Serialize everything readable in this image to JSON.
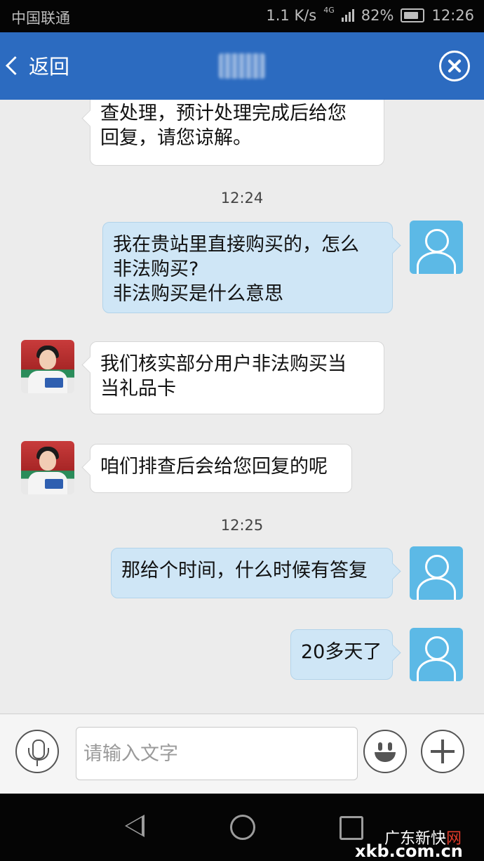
{
  "status_bar": {
    "carrier": "中国联通",
    "network_speed": "1.1 K/s",
    "network_type": "4G",
    "battery_percent": "82%",
    "time": "12:26"
  },
  "nav_bar": {
    "back_label": "返回",
    "color": "#2c6bc0"
  },
  "messages": [
    {
      "sender": "agent",
      "lines": [
        "查处理，预计处理完成后给您",
        "回复，请您谅解。"
      ]
    },
    {
      "timestamp": "12:24"
    },
    {
      "sender": "user",
      "lines": [
        "我在贵站里直接购买的，怎么",
        "非法购买?",
        "非法购买是什么意思"
      ]
    },
    {
      "sender": "agent",
      "lines": [
        "我们核实部分用户非法购买当",
        "当礼品卡"
      ]
    },
    {
      "sender": "agent",
      "lines": [
        "咱们排查后会给您回复的呢"
      ]
    },
    {
      "timestamp": "12:25"
    },
    {
      "sender": "user",
      "lines": [
        "那给个时间，什么时候有答复"
      ]
    },
    {
      "sender": "user",
      "lines": [
        "20多天了"
      ]
    }
  ],
  "input_bar": {
    "placeholder": "请输入文字"
  },
  "watermark": {
    "name_prefix": "广东新快",
    "name_accent": "网",
    "url": "xkb.com.cn"
  },
  "colors": {
    "user_bubble": "#cfe6f6",
    "agent_bubble": "#ffffff",
    "user_avatar": "#5cb9e6",
    "watermark_accent": "#e23b2a"
  }
}
